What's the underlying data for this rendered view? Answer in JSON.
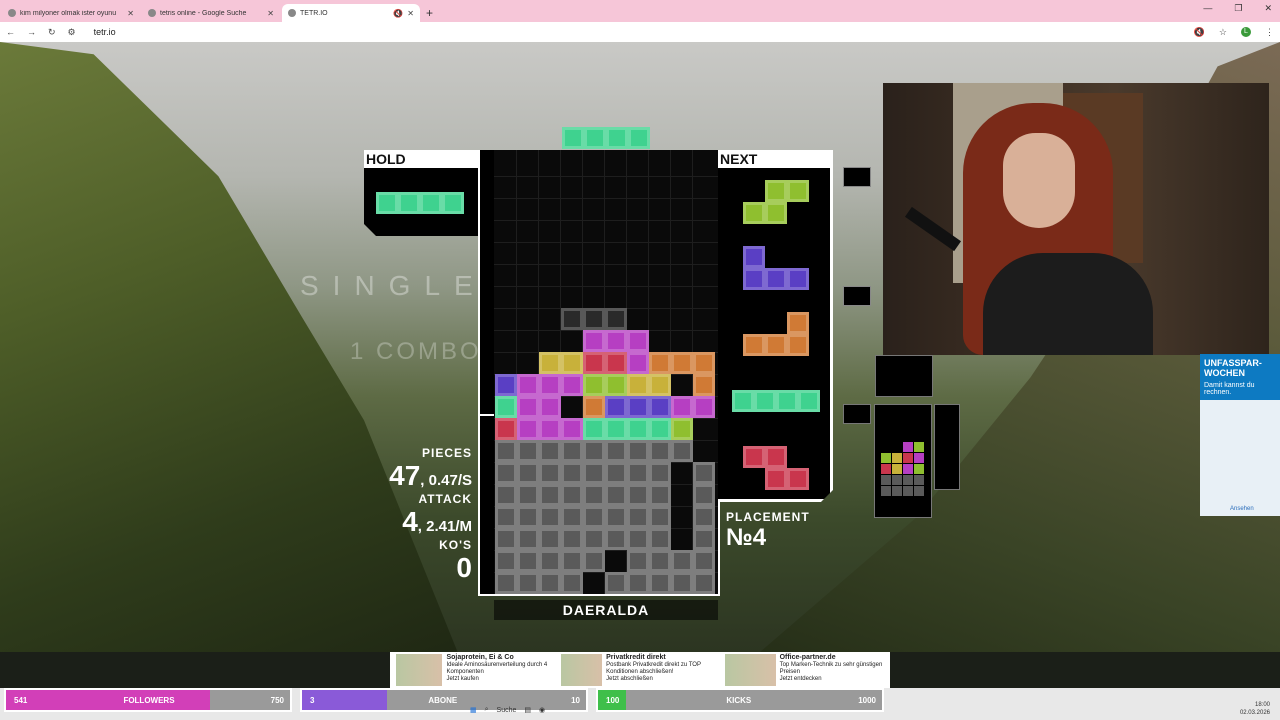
{
  "browser": {
    "tabs": [
      {
        "title": "kim milyoner olmak ister oyunu",
        "active": false
      },
      {
        "title": "tetris online - Google Suche",
        "active": false
      },
      {
        "title": "TETR.IO",
        "active": true
      }
    ],
    "url": "tetr.io",
    "profile_initial": "L"
  },
  "game": {
    "hold_label": "HOLD",
    "next_label": "NEXT",
    "clear_text": "SINGLE",
    "combo_text": "1 COMBO",
    "stats": {
      "pieces_label": "PIECES",
      "pieces_value": "47",
      "pieces_rate": "0.47/S",
      "attack_label": "ATTACK",
      "attack_value": "4",
      "attack_rate": "2.41/M",
      "kos_label": "KO'S",
      "kos_value": "0"
    },
    "placement_label": "PLACEMENT",
    "placement_value": "№4",
    "player_name": "DAERALDA",
    "colors": {
      "I": "#3fd28f",
      "O": "#c8b13a",
      "T": "#b63fc2",
      "S": "#8fbf2f",
      "Z": "#c9364d",
      "L": "#d07a35",
      "J": "#5a3fc4",
      "garbage": "#5a5a5a"
    },
    "hold_piece": "I",
    "queue": [
      "S",
      "J",
      "L",
      "I",
      "Z"
    ],
    "board_rows": [
      "..........",
      "..........",
      "..........",
      "..........",
      "..........",
      "..........",
      "..........",
      "...XXX....",
      "....TTT...",
      "..OOZZTLLL",
      "JTTTSSOO.L",
      "ITT.LJJJTT",
      "ZTTTIIIIS.",
      "GGGGGGGGG.",
      "GGGGGGGG.G",
      "GGGGGGGG.G",
      "GGGGGGGG.G",
      "GGGGGGGG.G",
      "GGGGG.GGGG",
      "GGGG.GGGGG"
    ]
  },
  "ads": {
    "right": {
      "title": "UNFASSPAR-WOCHEN",
      "subtitle": "Damit kannst du rechnen.",
      "footer": "Ansehen"
    },
    "bottom": [
      {
        "title": "Sojaprotein, Ei & Co",
        "text": "Ideale Aminosäurenverteilung durch 4 Komponenten",
        "cta": "Jetzt kaufen"
      },
      {
        "title": "Privatkredit direkt",
        "text": "Postbank Privatkredit direkt zu TOP Konditionen abschließen!",
        "cta": "Jetzt abschließen"
      },
      {
        "title": "Office-partner.de",
        "text": "Top Marken-Technik zu sehr günstigen Preisen",
        "cta": "Jetzt entdecken"
      }
    ]
  },
  "stream_bars": [
    {
      "current": "541",
      "label": "FOLLOWERS",
      "goal": "750",
      "progress": 0.72,
      "color": "#d23fb8"
    },
    {
      "current": "3",
      "label": "ABONE",
      "goal": "10",
      "progress": 0.3,
      "color": "#8a5ad8"
    },
    {
      "current": "100",
      "label": "KICKS",
      "goal": "1000",
      "progress": 0.1,
      "color": "#3fbf4a"
    }
  ],
  "taskbar": {
    "search": "Suche",
    "time": "18:00",
    "date": "02.03.2026"
  }
}
